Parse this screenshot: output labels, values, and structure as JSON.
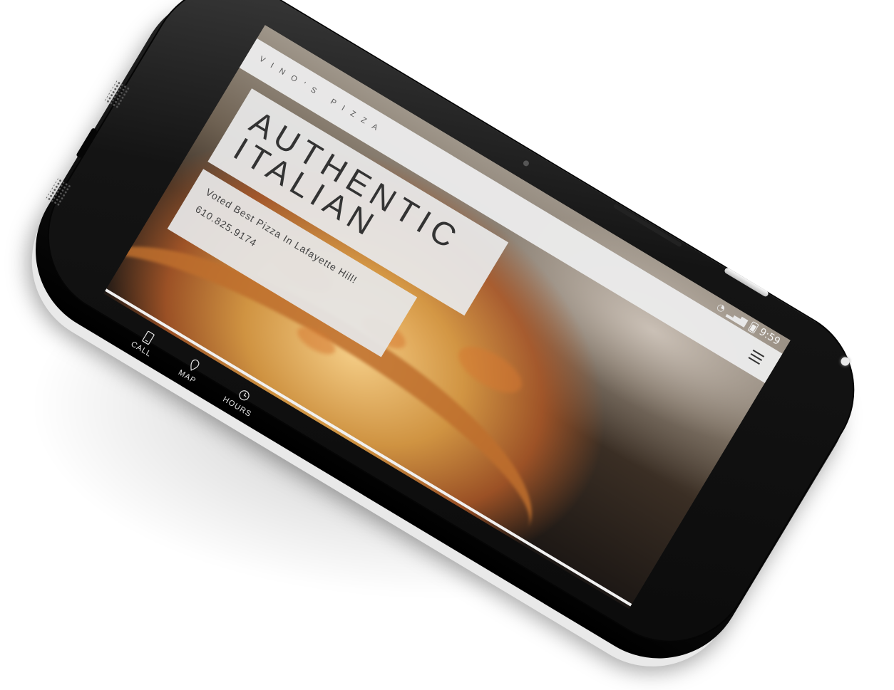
{
  "status_bar": {
    "time": "9:59"
  },
  "header": {
    "brand": "VINO'S PIZZA",
    "menu_icon": "hamburger-menu-icon"
  },
  "hero": {
    "title_line1": "AUTHENTIC",
    "title_line2": "ITALIAN",
    "tagline": "Voted Best Pizza In Lafayette Hill!",
    "phone": "610.825.9174"
  },
  "nav": [
    {
      "label": "CALL",
      "icon": "phone-icon"
    },
    {
      "label": "MAP",
      "icon": "map-pin-icon"
    },
    {
      "label": "HOURS",
      "icon": "clock-icon"
    }
  ],
  "colors": {
    "bezel": "#0b0b0b",
    "panel": "#e8e8e8",
    "text_dark": "#333333",
    "nav_text": "#e7e7e7"
  }
}
